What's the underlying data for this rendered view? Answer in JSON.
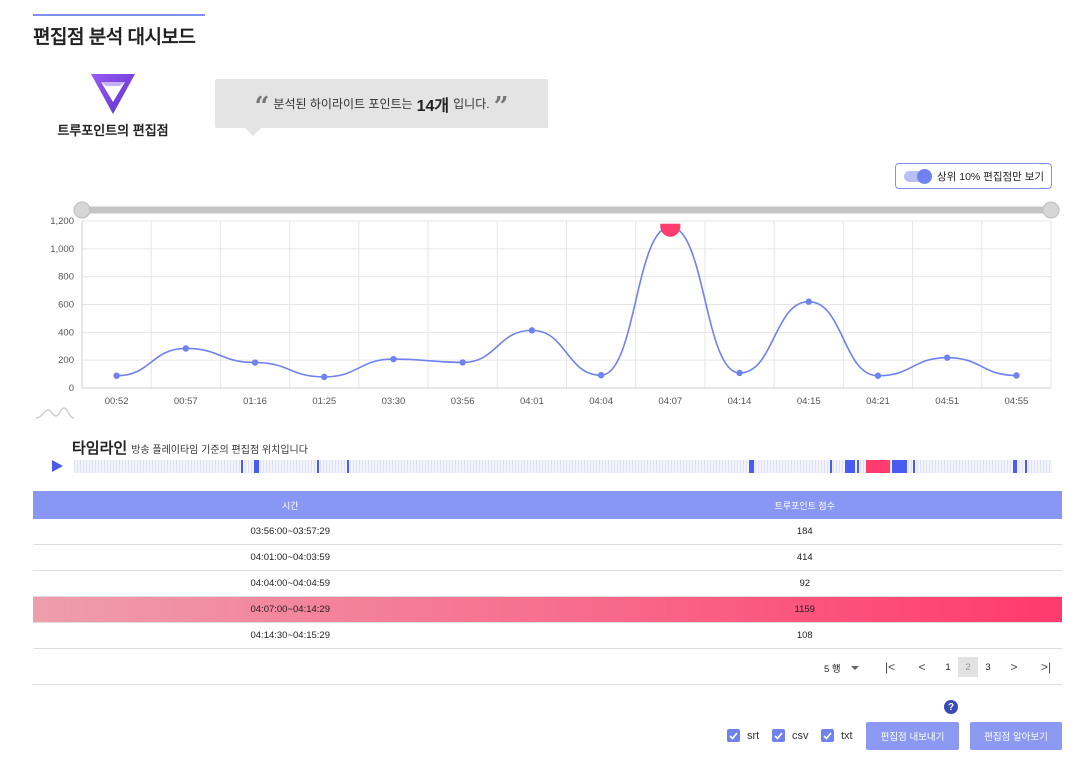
{
  "page": {
    "title": "편집점 분석 대시보드"
  },
  "brand": {
    "label": "트루포인트의 편집점"
  },
  "summary": {
    "prefix": "분석된 하이라이트 포인트는",
    "count": "14개",
    "suffix": "입니다."
  },
  "toggle": {
    "label": "상위 10% 편집점만 보기",
    "on": true
  },
  "colors": {
    "accent": "#7f8ff4",
    "line": "#6f82ef",
    "highlight": "#ff3c6e",
    "timeline_mark": "#4a5cf0"
  },
  "chart_data": {
    "type": "line",
    "categories": [
      "00:52",
      "00:57",
      "01:16",
      "01:25",
      "03:30",
      "03:56",
      "04:01",
      "04:04",
      "04:07",
      "04:14",
      "04:15",
      "04:21",
      "04:51",
      "04:55"
    ],
    "values": [
      88,
      284,
      183,
      80,
      208,
      184,
      414,
      92,
      1159,
      108,
      620,
      88,
      218,
      90
    ],
    "y_ticks": [
      "0",
      "200",
      "400",
      "600",
      "800",
      "1,000",
      "1,200"
    ],
    "ylim": [
      0,
      1200
    ],
    "highlight_index": 8,
    "grid": true
  },
  "timeline": {
    "title": "타임라인",
    "subtitle": "방송 플레이타임 기준의 편집점 위치입니다",
    "marks": [
      {
        "start": 0.171,
        "end": 0.173,
        "hot": false
      },
      {
        "start": 0.184,
        "end": 0.189,
        "hot": false
      },
      {
        "start": 0.248,
        "end": 0.251,
        "hot": false
      },
      {
        "start": 0.279,
        "end": 0.281,
        "hot": false
      },
      {
        "start": 0.69,
        "end": 0.695,
        "hot": false
      },
      {
        "start": 0.773,
        "end": 0.775,
        "hot": false
      },
      {
        "start": 0.788,
        "end": 0.799,
        "hot": false
      },
      {
        "start": 0.801,
        "end": 0.803,
        "hot": false
      },
      {
        "start": 0.81,
        "end": 0.834,
        "hot": true
      },
      {
        "start": 0.836,
        "end": 0.852,
        "hot": false
      },
      {
        "start": 0.858,
        "end": 0.86,
        "hot": false
      },
      {
        "start": 0.96,
        "end": 0.964,
        "hot": false
      },
      {
        "start": 0.972,
        "end": 0.974,
        "hot": false
      }
    ]
  },
  "table": {
    "headers": [
      "시간",
      "트루포인트 점수"
    ],
    "rows": [
      {
        "time": "03:56:00~03:57:29",
        "score": "184"
      },
      {
        "time": "04:01:00~04:03:59",
        "score": "414"
      },
      {
        "time": "04:04:00~04:04:59",
        "score": "92"
      },
      {
        "time": "04:07:00~04:14:29",
        "score": "1159"
      },
      {
        "time": "04:14:30~04:15:29",
        "score": "108"
      }
    ]
  },
  "pagination": {
    "rows_per_page": "5 행",
    "first_icon": "|<",
    "prev_icon": "<",
    "next_icon": ">",
    "last_icon": ">|",
    "pages": [
      "1",
      "2",
      "3"
    ],
    "current": "2"
  },
  "export": {
    "help": "?",
    "formats": [
      {
        "label": "srt",
        "checked": true
      },
      {
        "label": "csv",
        "checked": true
      },
      {
        "label": "txt",
        "checked": true
      }
    ],
    "export_button": "편집점 내보내기",
    "learn_button": "편집점 알아보기"
  }
}
